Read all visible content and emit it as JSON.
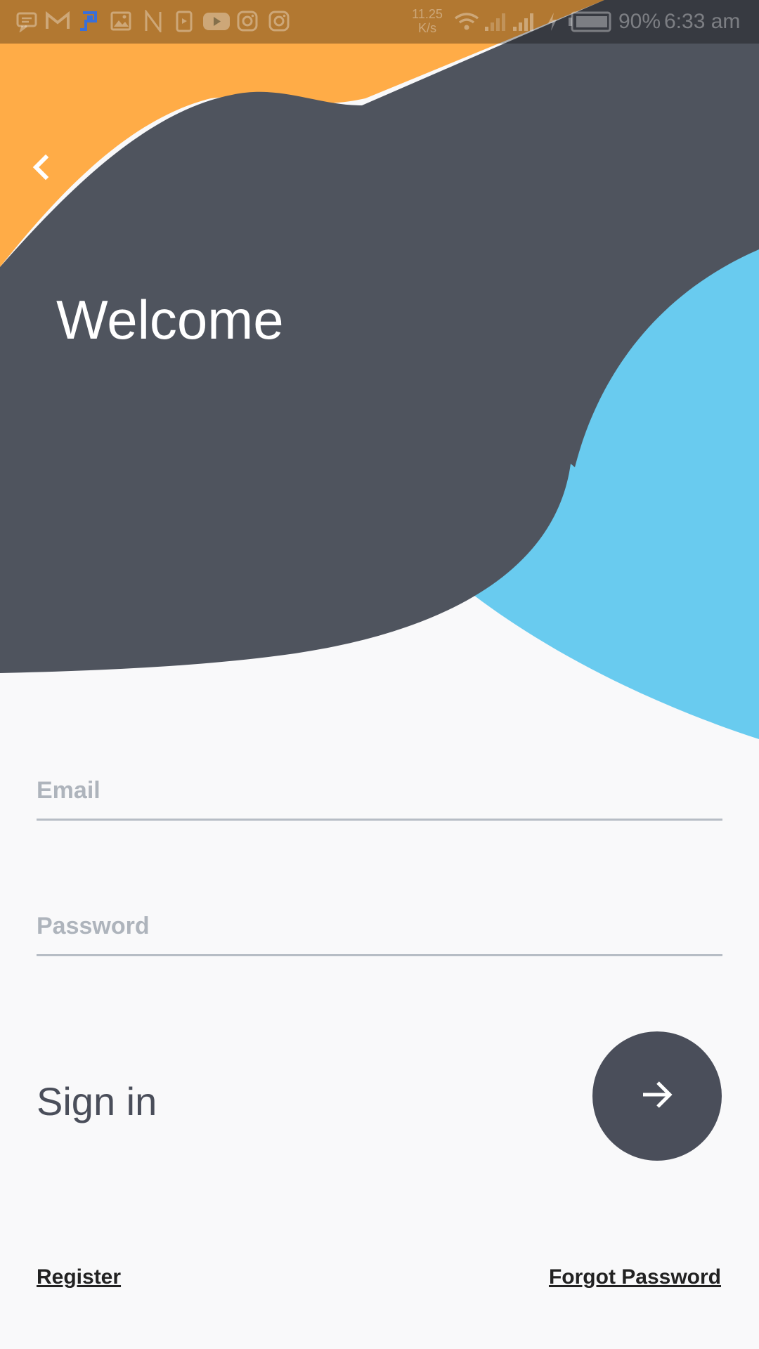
{
  "status_bar": {
    "network_speed_value": "11.25",
    "network_speed_unit": "K/s",
    "battery_percent": "90%",
    "time": "6:33 am",
    "notification_icons": [
      "message-icon",
      "gmail-icon",
      "app-icon",
      "gallery-icon",
      "n-app-icon",
      "video-app-icon",
      "youtube-icon",
      "instagram-icon",
      "instagram-icon"
    ]
  },
  "colors": {
    "background": "#F9F9FA",
    "dark": "#4F545E",
    "orange": "#FFAC47",
    "blue": "#69CBEF",
    "placeholder": "#AEB4BC",
    "underline": "#B7BDC5"
  },
  "header": {
    "title": "Welcome",
    "back_icon": "chevron-left-icon"
  },
  "form": {
    "email_placeholder": "Email",
    "password_placeholder": "Password",
    "signin_label": "Sign in",
    "submit_icon": "arrow-right-icon"
  },
  "footer": {
    "register_label": "Register",
    "forgot_password_label": "Forgot Password"
  }
}
